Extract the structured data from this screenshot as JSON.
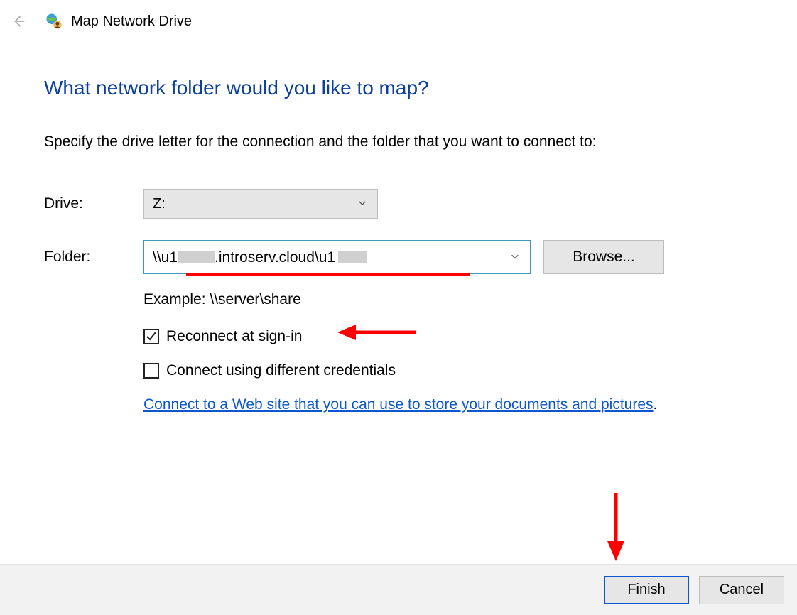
{
  "titlebar": {
    "app_title": "Map Network Drive"
  },
  "main": {
    "heading": "What network folder would you like to map?",
    "instruction": "Specify the drive letter for the connection and the folder that you want to connect to:",
    "drive_label": "Drive:",
    "drive_value": "Z:",
    "folder_label": "Folder:",
    "folder_value_part1": "\\\\u1",
    "folder_value_part2": ".introserv.cloud\\u1",
    "browse_label": "Browse...",
    "example_text": "Example: \\\\server\\share",
    "checkbox_reconnect": "Reconnect at sign-in",
    "checkbox_reconnect_checked": true,
    "checkbox_credentials": "Connect using different credentials",
    "checkbox_credentials_checked": false,
    "link_text": "Connect to a Web site that you can use to store your documents and pictures",
    "link_suffix": "."
  },
  "footer": {
    "finish_label": "Finish",
    "cancel_label": "Cancel"
  },
  "annotations": {
    "underline_color": "#ff0000",
    "arrow_color": "#ff0000"
  }
}
